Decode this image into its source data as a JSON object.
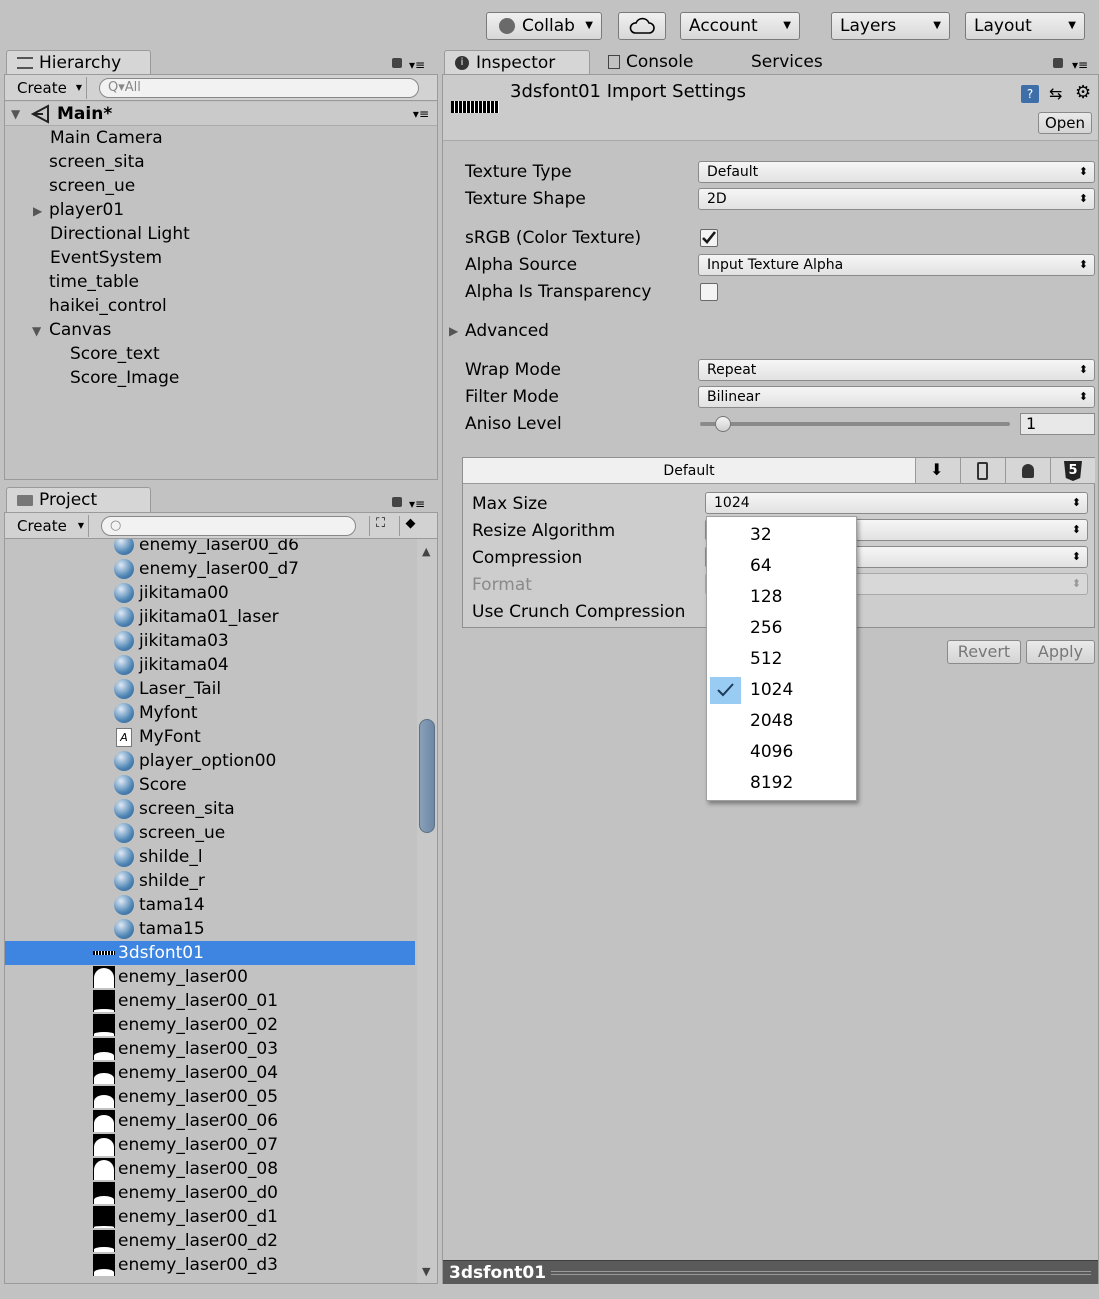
{
  "toolbar": {
    "collab": "Collab",
    "account": "Account",
    "layers": "Layers",
    "layout": "Layout"
  },
  "hierarchy": {
    "tab": "Hierarchy",
    "create": "Create",
    "search_placeholder": "All",
    "scene": "Main*",
    "items": [
      "Main Camera",
      "screen_sita",
      "screen_ue",
      "player01",
      "Directional Light",
      "EventSystem",
      "time_table",
      "haikei_control",
      "Canvas",
      "Score_text",
      "Score_Image"
    ]
  },
  "project": {
    "tab": "Project",
    "create": "Create",
    "items": [
      {
        "name": "enemy_laser00_d6",
        "icon": "sphere-icon"
      },
      {
        "name": "enemy_laser00_d7",
        "icon": "sphere-icon"
      },
      {
        "name": "jikitama00",
        "icon": "sphere-icon"
      },
      {
        "name": "jikitama01_laser",
        "icon": "sphere-icon"
      },
      {
        "name": "jikitama03",
        "icon": "sphere-icon"
      },
      {
        "name": "jikitama04",
        "icon": "sphere-icon"
      },
      {
        "name": "Laser_Tail",
        "icon": "sphere-icon"
      },
      {
        "name": "Myfont",
        "icon": "sphere-icon"
      },
      {
        "name": "MyFont",
        "icon": "font-icon"
      },
      {
        "name": "player_option00",
        "icon": "sphere-icon"
      },
      {
        "name": "Score",
        "icon": "sphere-icon"
      },
      {
        "name": "screen_sita",
        "icon": "sphere-icon"
      },
      {
        "name": "screen_ue",
        "icon": "sphere-icon"
      },
      {
        "name": "shilde_l",
        "icon": "sphere-icon"
      },
      {
        "name": "shilde_r",
        "icon": "sphere-icon"
      },
      {
        "name": "tama14",
        "icon": "sphere-icon"
      },
      {
        "name": "tama15",
        "icon": "sphere-icon"
      },
      {
        "name": "3dsfont01",
        "icon": "texture-icon"
      },
      {
        "name": "enemy_laser00",
        "icon": "texture-icon"
      },
      {
        "name": "enemy_laser00_01",
        "icon": "texture-icon"
      },
      {
        "name": "enemy_laser00_02",
        "icon": "texture-icon"
      },
      {
        "name": "enemy_laser00_03",
        "icon": "texture-icon"
      },
      {
        "name": "enemy_laser00_04",
        "icon": "texture-icon"
      },
      {
        "name": "enemy_laser00_05",
        "icon": "texture-icon"
      },
      {
        "name": "enemy_laser00_06",
        "icon": "texture-icon"
      },
      {
        "name": "enemy_laser00_07",
        "icon": "texture-icon"
      },
      {
        "name": "enemy_laser00_08",
        "icon": "texture-icon"
      },
      {
        "name": "enemy_laser00_d0",
        "icon": "texture-icon"
      },
      {
        "name": "enemy_laser00_d1",
        "icon": "texture-icon"
      },
      {
        "name": "enemy_laser00_d2",
        "icon": "texture-icon"
      },
      {
        "name": "enemy_laser00_d3",
        "icon": "texture-icon"
      }
    ],
    "selected": "3dsfont01"
  },
  "inspector": {
    "tabs": [
      "Inspector",
      "Console",
      "Services"
    ],
    "title": "3dsfont01 Import Settings",
    "open_button": "Open",
    "fields": {
      "texture_type_label": "Texture Type",
      "texture_type_value": "Default",
      "texture_shape_label": "Texture Shape",
      "texture_shape_value": "2D",
      "srgb_label": "sRGB (Color Texture)",
      "srgb_checked": true,
      "alpha_source_label": "Alpha Source",
      "alpha_source_value": "Input Texture Alpha",
      "alpha_transparency_label": "Alpha Is Transparency",
      "alpha_transparency_checked": false,
      "advanced_label": "Advanced",
      "wrap_mode_label": "Wrap Mode",
      "wrap_mode_value": "Repeat",
      "filter_mode_label": "Filter Mode",
      "filter_mode_value": "Bilinear",
      "aniso_label": "Aniso Level",
      "aniso_value": "1"
    },
    "platform": {
      "tab_label": "Default",
      "max_size_label": "Max Size",
      "max_size_value": "1024",
      "resize_label": "Resize Algorithm",
      "compression_label": "Compression",
      "format_label": "Format",
      "crunch_label": "Use Crunch Compression"
    },
    "revert": "Revert",
    "apply": "Apply",
    "footer": "3dsfont01"
  },
  "max_size_menu": {
    "options": [
      "32",
      "64",
      "128",
      "256",
      "512",
      "1024",
      "2048",
      "4096",
      "8192"
    ],
    "selected": "1024"
  }
}
